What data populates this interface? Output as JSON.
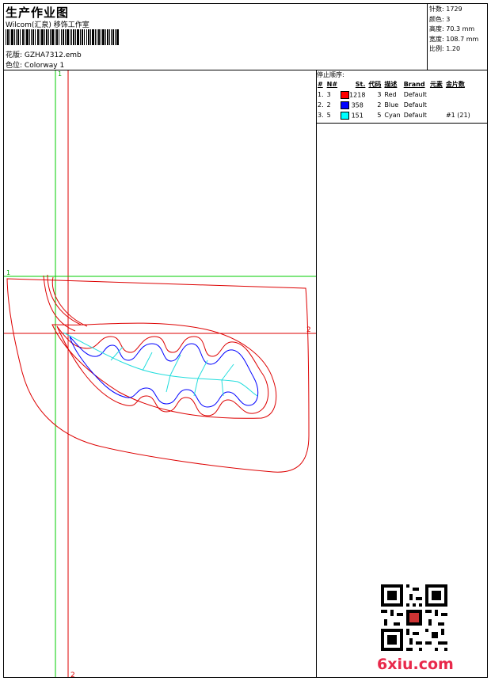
{
  "header": {
    "title": "生产作业图",
    "subtitle": "Wilcom(汇泉) 移饰工作室",
    "design_label": "花版:",
    "design_value": "GZHA7312.emb",
    "colorway_label": "色位:",
    "colorway_value": "Colorway 1"
  },
  "stats": {
    "stitches_label": "针数:",
    "stitches_value": "1729",
    "colors_label": "颜色:",
    "colors_value": "3",
    "height_label": "高度:",
    "height_value": "70.3 mm",
    "width_label": "宽度:",
    "width_value": "108.7 mm",
    "scale_label": "比例:",
    "scale_value": "1.20"
  },
  "stop_sequence": {
    "title": "停止顺序:",
    "headers": [
      "#",
      "N#",
      "St.",
      "代码",
      "描述",
      "Brand",
      "元素",
      "金片数"
    ],
    "rows": [
      {
        "index": "1.",
        "needle": "3",
        "color": "#ff0000",
        "stitches": "1218",
        "code": "3",
        "desc": "Red",
        "brand": "Default",
        "element": "",
        "sequins": ""
      },
      {
        "index": "2.",
        "needle": "2",
        "color": "#0000ff",
        "stitches": "358",
        "code": "2",
        "desc": "Blue",
        "brand": "Default",
        "element": "",
        "sequins": ""
      },
      {
        "index": "3.",
        "needle": "5",
        "color": "#00ffff",
        "stitches": "151",
        "code": "5",
        "desc": "Cyan",
        "brand": "Default",
        "element": "",
        "sequins": "#1 (21)"
      }
    ]
  },
  "guides": {
    "green_v_label": "1",
    "red_v_label": "2",
    "green_h_label": "1",
    "red_h_label": "2"
  },
  "colors": {
    "guide_green": "#00cc00",
    "guide_red": "#dd0000",
    "outline_red": "#dd0000",
    "inner_blue": "#0000ff",
    "center_cyan": "#22dddd"
  },
  "watermark": "6xiu.com"
}
